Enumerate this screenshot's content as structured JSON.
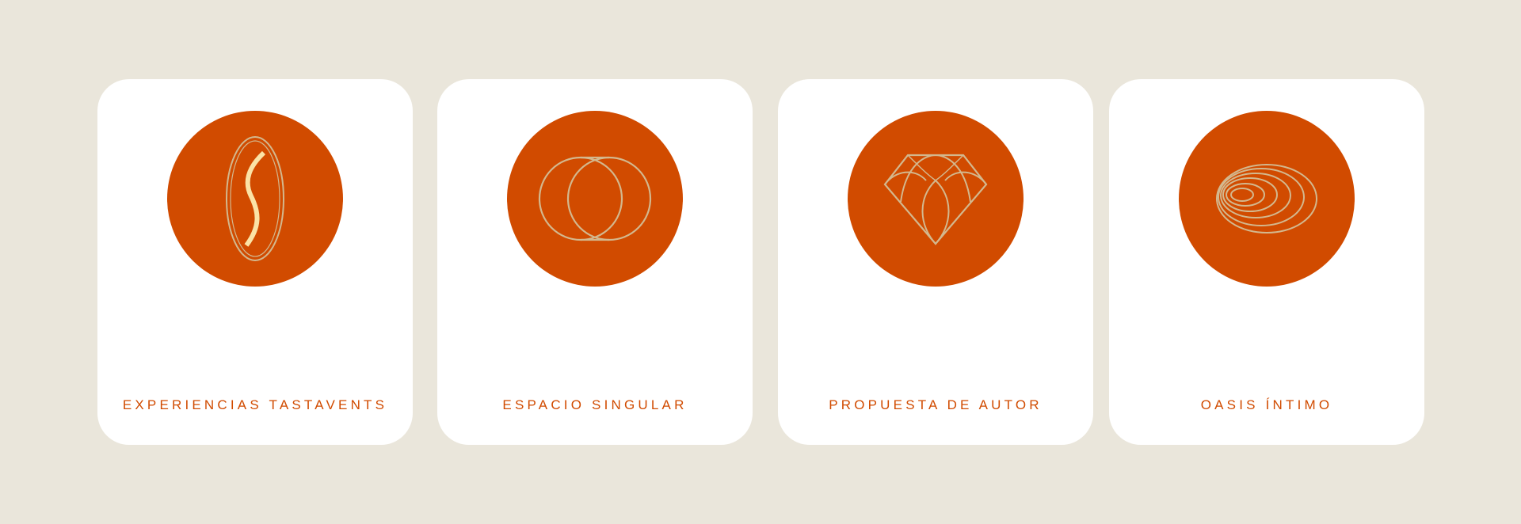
{
  "colors": {
    "page_background": "#eae6db",
    "card_background": "#ffffff",
    "accent": "#d14b00",
    "icon_line": "#d3b88e",
    "icon_highlight": "#fbe3a6"
  },
  "cards": [
    {
      "label": "EXPERIENCIAS TASTAVENTS",
      "icon": "s-oval-icon"
    },
    {
      "label": "ESPACIO SINGULAR",
      "icon": "interlocking-circles-icon"
    },
    {
      "label": "PROPUESTA DE AUTOR",
      "icon": "diamond-icon"
    },
    {
      "label": "OASIS ÍNTIMO",
      "icon": "concentric-ellipses-icon"
    }
  ]
}
